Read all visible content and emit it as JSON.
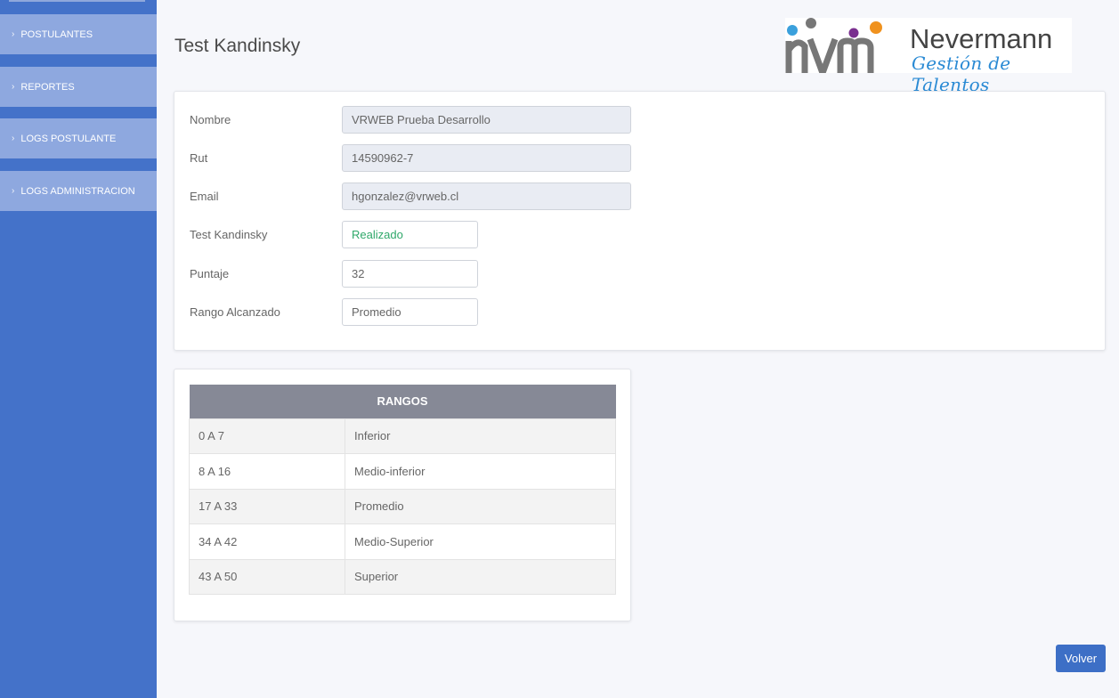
{
  "sidebar": {
    "items": [
      {
        "label": "POSTULANTES"
      },
      {
        "label": "REPORTES"
      },
      {
        "label": "LOGS POSTULANTE"
      },
      {
        "label": "LOGS ADMINISTRACION"
      }
    ]
  },
  "page": {
    "title": "Test Kandinsky"
  },
  "logo": {
    "brand": "Nevermann",
    "tagline": "Gestión de Talentos"
  },
  "form": {
    "nombre": {
      "label": "Nombre",
      "value": "VRWEB Prueba Desarrollo"
    },
    "rut": {
      "label": "Rut",
      "value": "14590962-7"
    },
    "email": {
      "label": "Email",
      "value": "hgonzalez@vrweb.cl"
    },
    "test": {
      "label": "Test Kandinsky",
      "value": "Realizado"
    },
    "puntaje": {
      "label": "Puntaje",
      "value": "32"
    },
    "rango": {
      "label": "Rango Alcanzado",
      "value": "Promedio"
    }
  },
  "rangos": {
    "header": "RANGOS",
    "rows": [
      {
        "range": "0 A 7",
        "name": "Inferior"
      },
      {
        "range": "8 A 16",
        "name": "Medio-inferior"
      },
      {
        "range": "17 A 33",
        "name": "Promedio"
      },
      {
        "range": "34 A 42",
        "name": "Medio-Superior"
      },
      {
        "range": "43 A 50",
        "name": "Superior"
      }
    ]
  },
  "actions": {
    "volver": "Volver"
  },
  "colors": {
    "sidebar": "#4472c9",
    "accent": "#3d6fc6",
    "status_ok": "#2fa86a",
    "table_header": "#868996"
  }
}
